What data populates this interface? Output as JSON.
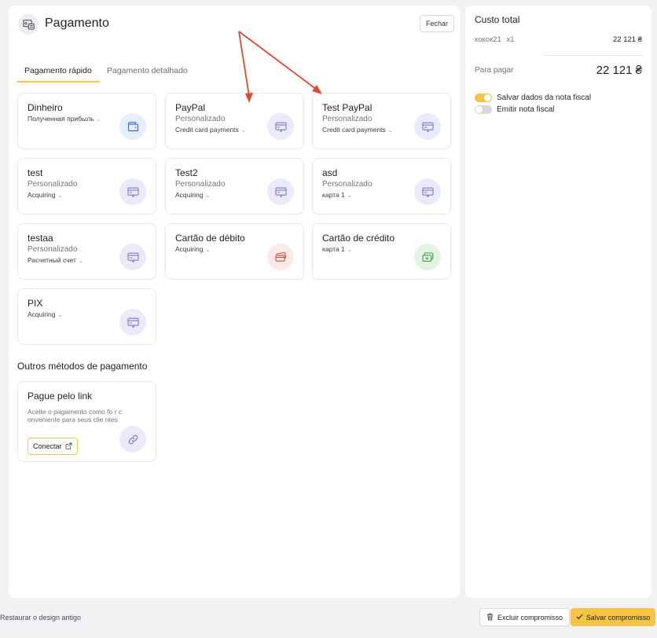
{
  "header": {
    "title": "Pagamento",
    "close_label": "Fechar"
  },
  "tabs": [
    {
      "label": "Pagamento rápido",
      "active": true
    },
    {
      "label": "Pagamento detalhado",
      "active": false
    }
  ],
  "methods": [
    {
      "title": "Dinheiro",
      "subtitle": "",
      "dropdown": "Полученная прибыль",
      "icon": "wallet-icon",
      "tone": "blue"
    },
    {
      "title": "PayPal",
      "subtitle": "Personalizado",
      "dropdown": "Credit card payments",
      "icon": "card-terminal-icon",
      "tone": "purple"
    },
    {
      "title": "Test PayPal",
      "subtitle": "Personalizado",
      "dropdown": "Credit card payments",
      "icon": "card-terminal-icon",
      "tone": "purple"
    },
    {
      "title": "test",
      "subtitle": "Personalizado",
      "dropdown": "Acquiring",
      "icon": "card-terminal-icon",
      "tone": "purple"
    },
    {
      "title": "Test2",
      "subtitle": "Personalizado",
      "dropdown": "Acquiring",
      "icon": "card-terminal-icon",
      "tone": "purple"
    },
    {
      "title": "asd",
      "subtitle": "Personalizado",
      "dropdown": "карта 1",
      "icon": "card-terminal-icon",
      "tone": "purple"
    },
    {
      "title": "testaa",
      "subtitle": "Personalizado",
      "dropdown": "Расчетный счет",
      "icon": "card-terminal-icon",
      "tone": "purple"
    },
    {
      "title": "Cartão de débito",
      "subtitle": "",
      "dropdown": "Acquiring",
      "icon": "debit-card-icon",
      "tone": "red"
    },
    {
      "title": "Cartão de crédito",
      "subtitle": "",
      "dropdown": "карта 1",
      "icon": "credit-card-icon",
      "tone": "green"
    },
    {
      "title": "PIX",
      "subtitle": "",
      "dropdown": "Acquiring",
      "icon": "card-terminal-icon",
      "tone": "purple"
    }
  ],
  "other_methods": {
    "title": "Outros métodos de pagamento",
    "link_card": {
      "title": "Pague pelo link",
      "description": "Aceite o pagamento como fo r conveniente para seus clie ntes",
      "button_label": "Conectar"
    }
  },
  "summary": {
    "title": "Custo total",
    "item_name": "кокок21",
    "item_qty": "x1",
    "item_price": "22 121 ₴",
    "pay_label": "Para pagar",
    "pay_value": "22 121 ₴",
    "toggles": [
      {
        "label": "Salvar dados da nota fiscal",
        "on": true
      },
      {
        "label": "Emitir nota fiscal",
        "on": false
      }
    ]
  },
  "footer": {
    "restore_label": "Restaurar o design antigo",
    "delete_label": "Excluir compromisso",
    "save_label": "Salvar compromisso"
  },
  "colors": {
    "accent": "#f6c443",
    "annotation_arrow": "#e0492e",
    "icon_purple_bg": "#ebeafb",
    "icon_purple_fg": "#7d77d8",
    "icon_blue_bg": "#e6efff",
    "icon_blue_fg": "#3c6ee0",
    "icon_red_bg": "#fde9e8",
    "icon_red_fg": "#e0453a",
    "icon_green_bg": "#e4f4e2",
    "icon_green_fg": "#3f9a42"
  }
}
